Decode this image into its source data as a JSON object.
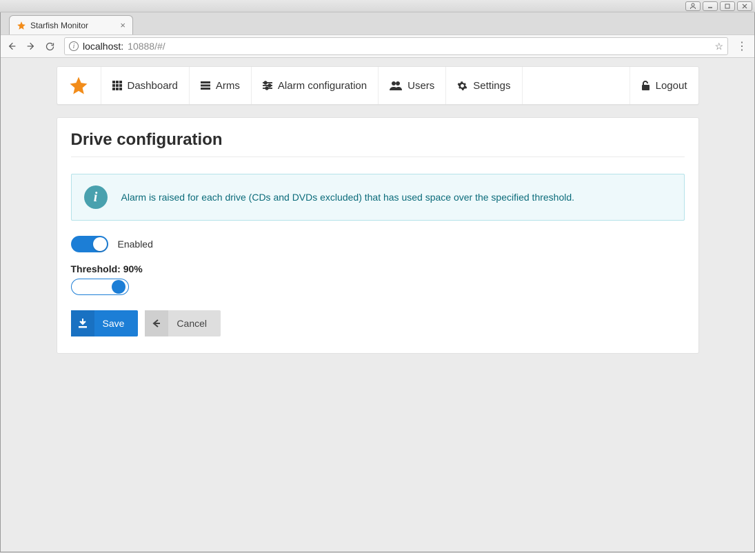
{
  "os": {
    "window_controls": [
      "user",
      "min",
      "max",
      "close"
    ]
  },
  "browser": {
    "tab_title": "Starfish Monitor",
    "url_host": "localhost:",
    "url_rest": "10888/#/"
  },
  "nav": {
    "items": [
      {
        "label": "Dashboard",
        "icon": "grid"
      },
      {
        "label": "Arms",
        "icon": "bars"
      },
      {
        "label": "Alarm configuration",
        "icon": "sliders"
      },
      {
        "label": "Users",
        "icon": "users"
      },
      {
        "label": "Settings",
        "icon": "gear"
      }
    ],
    "logout_label": "Logout"
  },
  "page": {
    "title": "Drive configuration",
    "info_text": "Alarm is raised for each drive (CDs and DVDs excluded) that has used space over the specified threshold.",
    "enabled_label": "Enabled",
    "enabled_value": true,
    "threshold_label": "Threshold: 90%",
    "threshold_value": 90,
    "save_label": "Save",
    "cancel_label": "Cancel"
  }
}
